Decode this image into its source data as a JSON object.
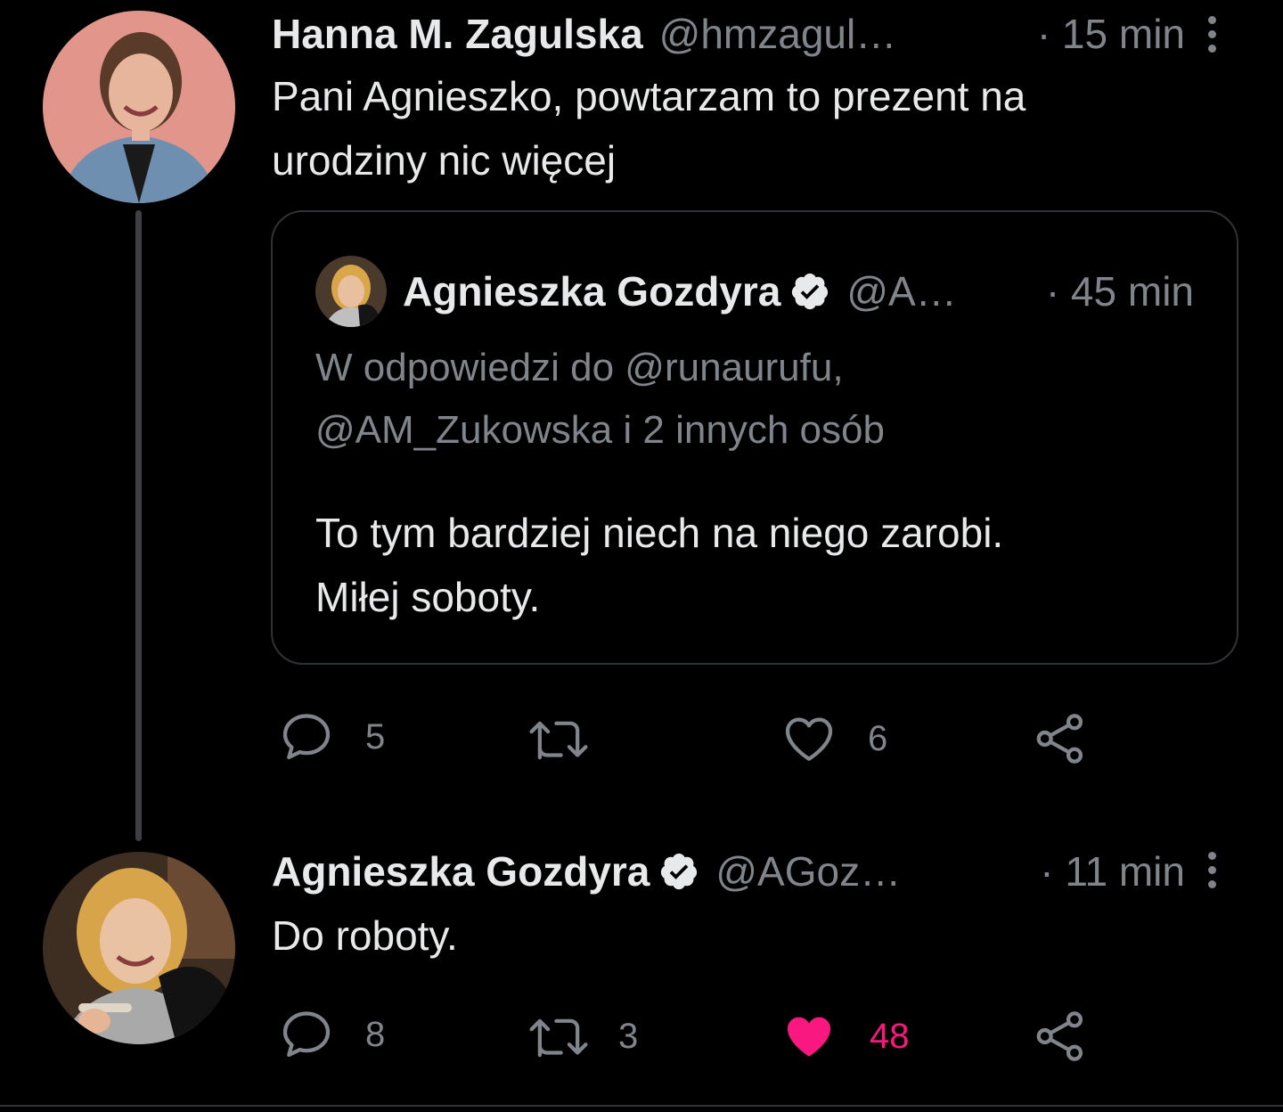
{
  "tweet_1": {
    "author_name": "Hanna M. Zagulska",
    "author_handle": "@hmzagul…",
    "time": "· 15 min",
    "text_line1": "Pani Agnieszko, powtarzam to prezent na",
    "text_line2": "urodziny nic więcej",
    "quote": {
      "author_name": "Agnieszka Gozdyra",
      "author_handle": "@A…",
      "time": "· 45 min",
      "reply_line1": "W odpowiedzi do @runaurufu,",
      "reply_line2": "@AM_Zukowska i 2 innych osób",
      "text_line1": "To tym bardziej niech na niego zarobi.",
      "text_line2": "Miłej soboty."
    },
    "actions": {
      "reply_count": "5",
      "retweet_count": "",
      "like_count": "6"
    }
  },
  "tweet_2": {
    "author_name": "Agnieszka Gozdyra",
    "author_handle": "@AGoz…",
    "time": "· 11 min",
    "text": "Do roboty.",
    "actions": {
      "reply_count": "8",
      "retweet_count": "3",
      "like_count": "48",
      "liked": true
    }
  },
  "colors": {
    "background": "#000000",
    "text_primary": "#e7e9ea",
    "text_secondary": "#7f858b",
    "like_active": "#f91880",
    "border": "#2f3336"
  },
  "icons": [
    "verified-badge-icon",
    "more-options-icon",
    "reply-icon",
    "retweet-icon",
    "like-icon",
    "share-icon"
  ]
}
